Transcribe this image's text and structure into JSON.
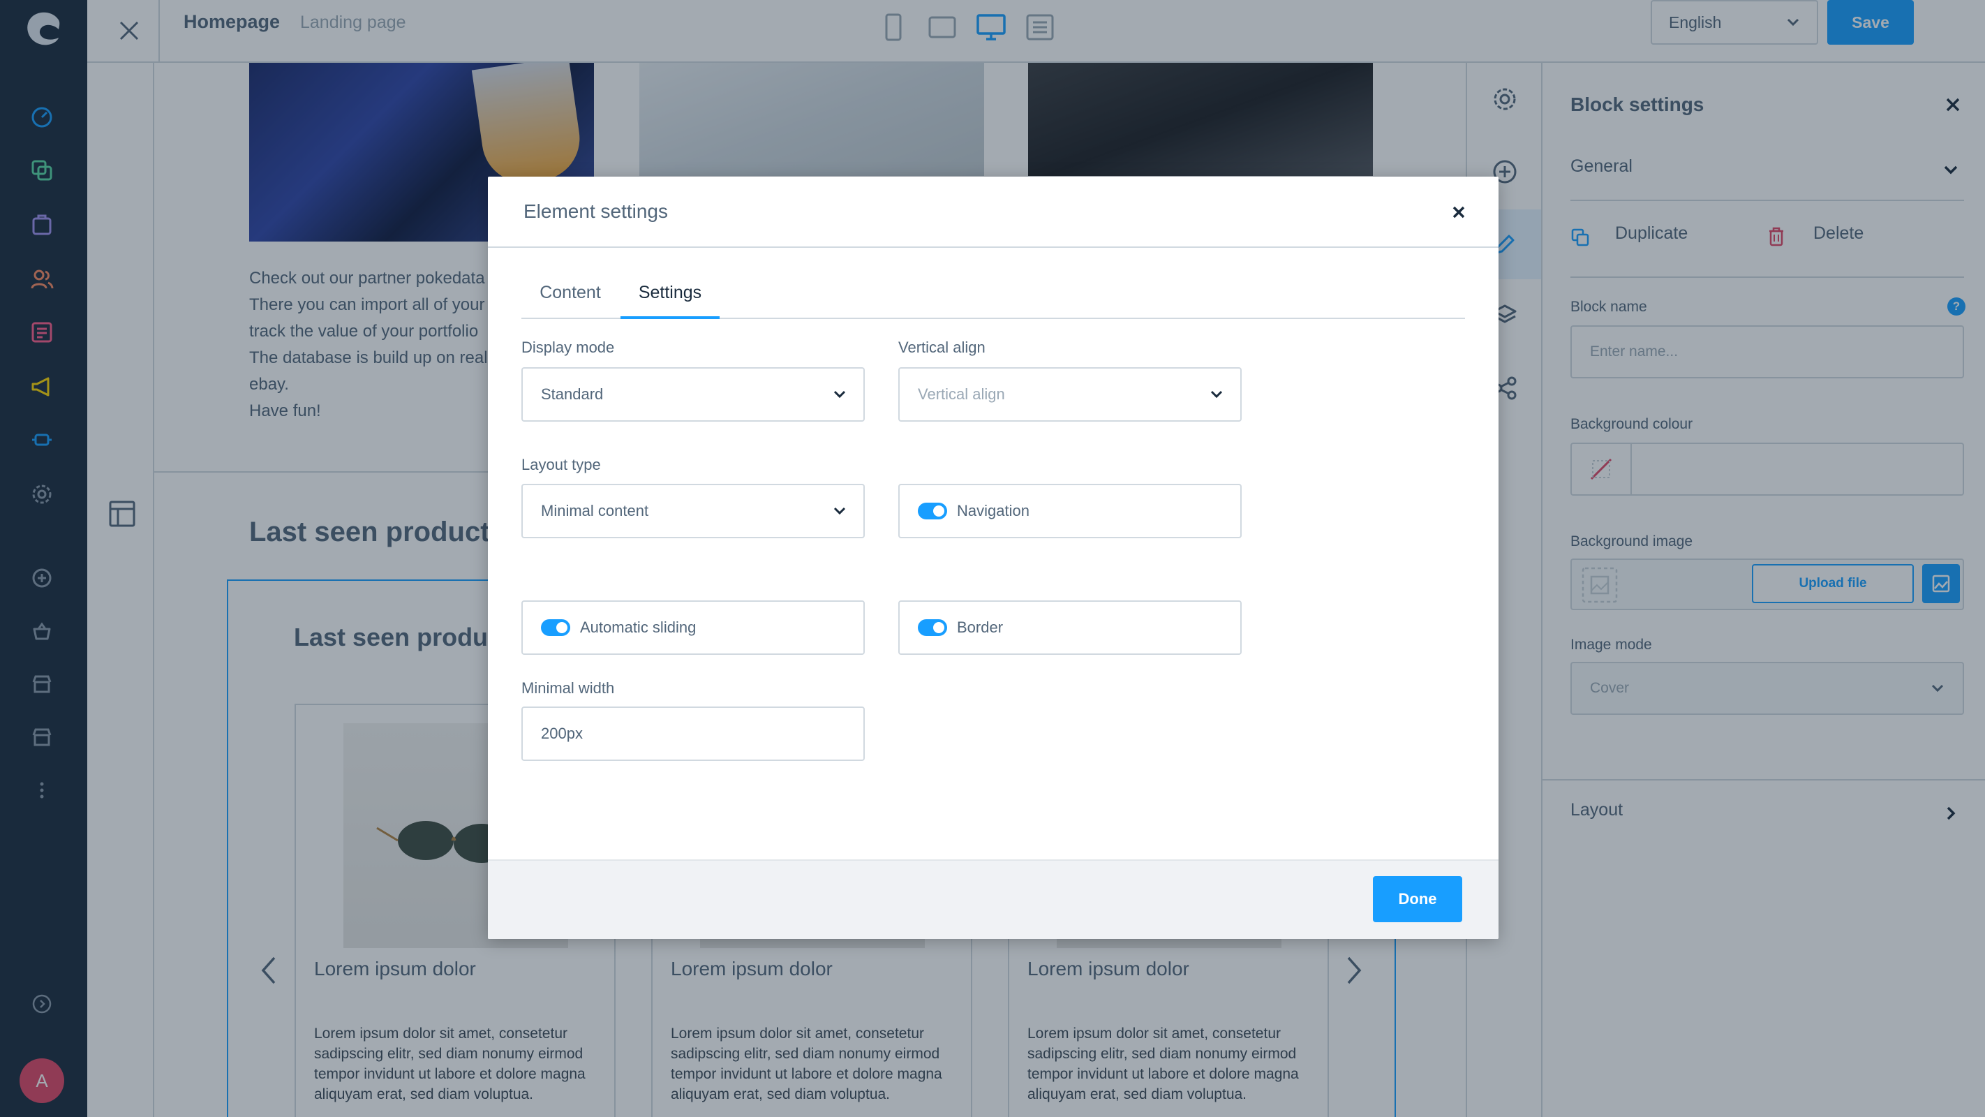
{
  "topbar": {
    "title": "Homepage",
    "subtitle": "Landing page",
    "language": "English",
    "save_label": "Save"
  },
  "canvas": {
    "partner_text": [
      "Check out our partner pokedata",
      "There you can import all of your",
      "track the value of your portfolio",
      "The database is build up on real",
      "ebay.",
      "Have fun!"
    ],
    "heading": "Last seen product",
    "block_heading": "Last seen produc",
    "products": [
      {
        "name": "Lorem ipsum dolor",
        "description": "Lorem ipsum dolor sit amet, consetetur sadipscing elitr, sed diam nonumy eirmod tempor invidunt ut labore et dolore magna aliquyam erat, sed diam voluptua."
      },
      {
        "name": "Lorem ipsum dolor",
        "description": "Lorem ipsum dolor sit amet, consetetur sadipscing elitr, sed diam nonumy eirmod tempor invidunt ut labore et dolore magna aliquyam erat, sed diam voluptua."
      },
      {
        "name": "Lorem ipsum dolor",
        "description": "Lorem ipsum dolor sit amet, consetetur sadipscing elitr, sed diam nonumy eirmod tempor invidunt ut labore et dolore magna aliquyam erat, sed diam voluptua."
      }
    ]
  },
  "panel": {
    "title": "Block settings",
    "general": "General",
    "duplicate": "Duplicate",
    "delete": "Delete",
    "block_name_label": "Block name",
    "block_name_placeholder": "Enter name...",
    "help": "?",
    "bg_colour_label": "Background colour",
    "bg_image_label": "Background image",
    "upload_label": "Upload file",
    "image_mode_label": "Image mode",
    "image_mode_value": "Cover",
    "layout": "Layout"
  },
  "modal": {
    "title": "Element settings",
    "tabs": [
      "Content",
      "Settings"
    ],
    "active_tab": "Settings",
    "display_mode_label": "Display mode",
    "display_mode_value": "Standard",
    "vertical_align_label": "Vertical align",
    "vertical_align_placeholder": "Vertical align",
    "layout_type_label": "Layout type",
    "layout_type_value": "Minimal content",
    "navigation_label": "Navigation",
    "navigation_on": true,
    "auto_sliding_label": "Automatic sliding",
    "auto_sliding_on": true,
    "border_label": "Border",
    "border_on": true,
    "min_width_label": "Minimal width",
    "min_width_value": "200px",
    "done_label": "Done"
  },
  "sidebar": {
    "avatar_initial": "A",
    "icons": [
      "dashboard-icon",
      "catalogues-icon",
      "orders-icon",
      "customers-icon",
      "content-icon",
      "marketing-icon",
      "extensions-icon",
      "settings-icon",
      "add-icon",
      "basket-icon",
      "storefront-icon",
      "storefront-2-icon",
      "more-icon",
      "help-icon"
    ]
  },
  "colors": {
    "sidebar_bg": "#1a2b3d",
    "accent": "#189eff",
    "text": "#52667a",
    "avatar": "#e04766"
  }
}
